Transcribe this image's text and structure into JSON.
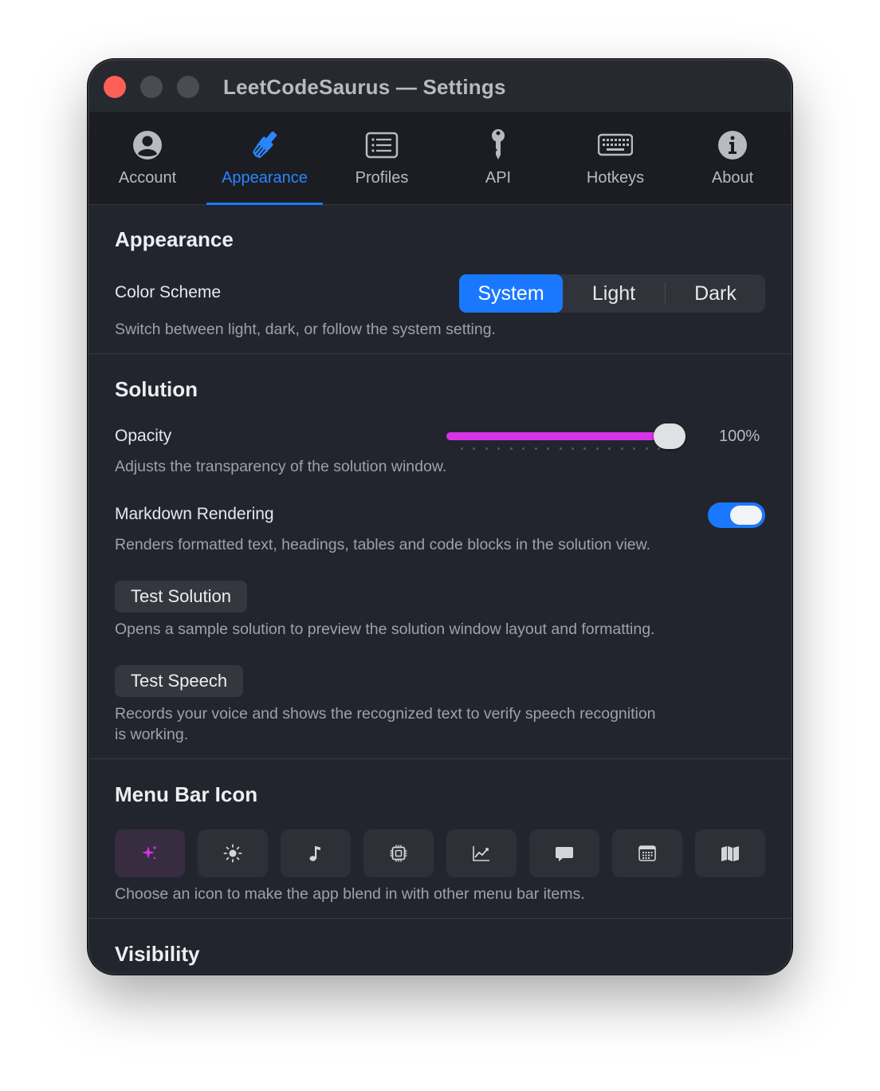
{
  "window": {
    "title": "LeetCodeSaurus — Settings"
  },
  "tabs": [
    {
      "label": "Account",
      "icon": "person-circle-icon"
    },
    {
      "label": "Appearance",
      "icon": "paintbrush-icon",
      "active": true
    },
    {
      "label": "Profiles",
      "icon": "list-icon"
    },
    {
      "label": "API",
      "icon": "key-icon"
    },
    {
      "label": "Hotkeys",
      "icon": "keyboard-icon"
    },
    {
      "label": "About",
      "icon": "info-icon"
    }
  ],
  "appearance": {
    "title": "Appearance",
    "color_scheme": {
      "label": "Color Scheme",
      "options": [
        "System",
        "Light",
        "Dark"
      ],
      "selected": "System",
      "description": "Switch between light, dark, or follow the system setting."
    }
  },
  "solution": {
    "title": "Solution",
    "opacity": {
      "label": "Opacity",
      "value": 1.0,
      "value_text": "100%",
      "description": "Adjusts the transparency of the solution window."
    },
    "markdown": {
      "label": "Markdown Rendering",
      "enabled": true,
      "description": "Renders formatted text, headings, tables and code blocks in the solution view."
    },
    "test_solution": {
      "label": "Test Solution",
      "description": "Opens a sample solution to preview the solution window layout and formatting."
    },
    "test_speech": {
      "label": "Test Speech",
      "description_line1": "Records your voice and shows the recognized text to verify speech recognition",
      "description_line2": "is working."
    }
  },
  "menu_bar_icon": {
    "title": "Menu Bar Icon",
    "icons": [
      "sparkles-icon",
      "sun-icon",
      "music-note-icon",
      "cpu-icon",
      "chart-line-icon",
      "speech-bubble-icon",
      "calendar-icon",
      "map-icon"
    ],
    "selected": "sparkles-icon",
    "description": "Choose an icon to make the app blend in with other menu bar items."
  },
  "visibility": {
    "title": "Visibility"
  },
  "colors": {
    "accent": "#1a78ff",
    "slider_fill": "#d634e6",
    "close_button": "#fe5f57"
  }
}
